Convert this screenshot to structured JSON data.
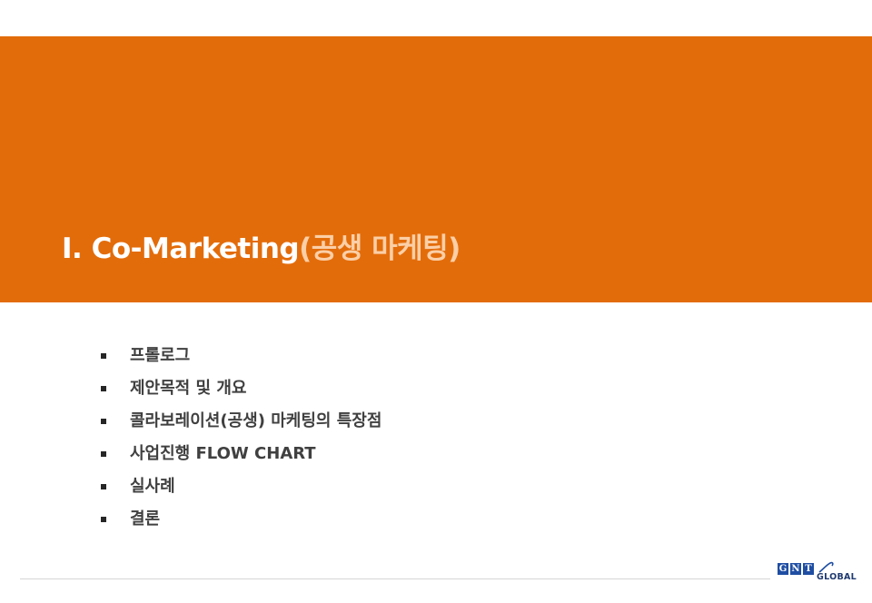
{
  "slide": {
    "title_main": "Ⅰ. Co-Marketing",
    "title_sub": "(공생 마케팅)"
  },
  "agenda": {
    "items": [
      "프롤로그",
      "제안목적 및 개요",
      "콜라보레이션(공생) 마케팅의 특장점",
      "사업진행 FLOW CHART",
      "실사례",
      "결론"
    ]
  },
  "logo": {
    "letters": [
      "G",
      "N",
      "T"
    ],
    "word": "GLOBAL"
  },
  "colors": {
    "banner": "#e36c0a",
    "title_sub": "#fbcfa7",
    "logo_blue": "#1f4ea3"
  }
}
